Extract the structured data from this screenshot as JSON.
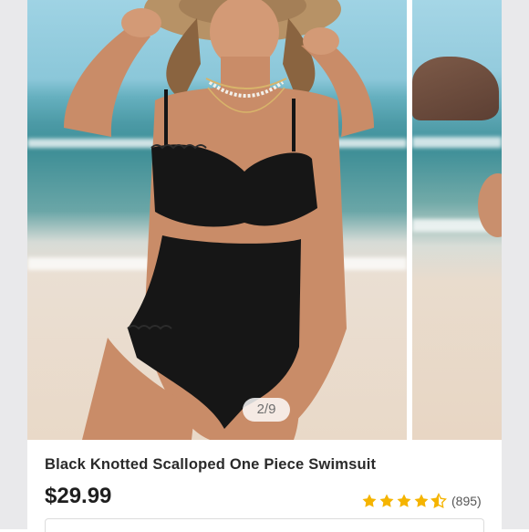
{
  "carousel": {
    "page_indicator": "2/9"
  },
  "listing": {
    "title": "Black Knotted Scalloped One Piece Swimsuit",
    "price": "$29.99",
    "rating": 4.5,
    "rating_count": "(895)",
    "star_color": "#f5b400"
  },
  "icons": {
    "star": "star-icon",
    "star_half": "star-half-icon"
  }
}
